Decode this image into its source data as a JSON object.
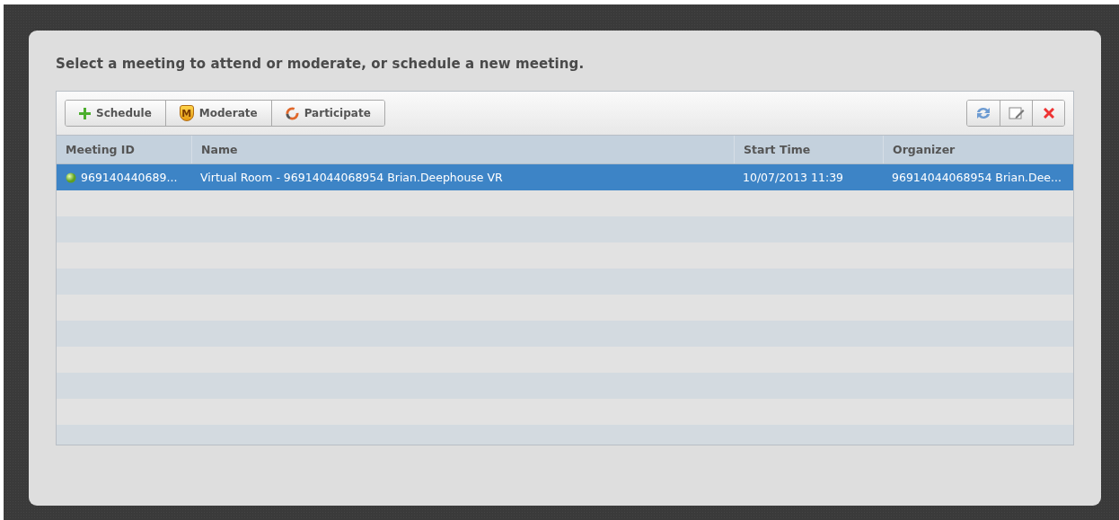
{
  "heading": "Select a meeting to attend or moderate, or schedule a new meeting.",
  "toolbar": [
    {
      "kind": "schedule",
      "label": "Schedule"
    },
    {
      "kind": "moderate",
      "label": "Moderate",
      "icon_letter": "M"
    },
    {
      "kind": "participate",
      "label": "Participate"
    }
  ],
  "tools": [
    {
      "kind": "refresh"
    },
    {
      "kind": "edit"
    },
    {
      "kind": "delete"
    }
  ],
  "table": {
    "columns": [
      "Meeting ID",
      "Name",
      "Start Time",
      "Organizer"
    ],
    "rows": [
      {
        "selected": true,
        "cells": [
          "969140440689...",
          "Virtual Room - 96914044068954 Brian.Deephouse VR",
          "10/07/2013 11:39",
          "96914044068954 Brian.Dee..."
        ]
      }
    ]
  }
}
